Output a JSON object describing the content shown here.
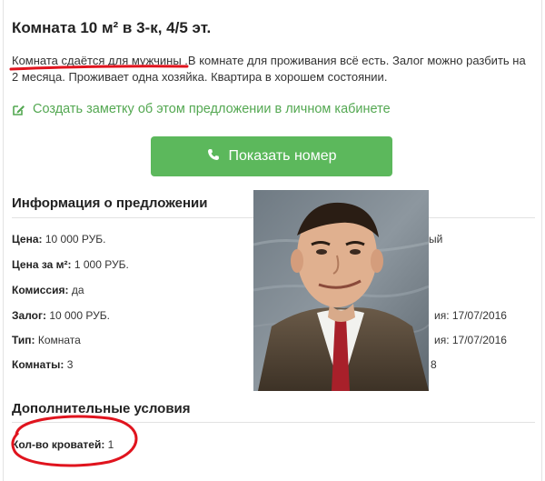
{
  "listing": {
    "title": "Комната 10 м² в 3-к, 4/5 эт.",
    "description_highlight": "Комната сдаётся для мужчины",
    "description_rest": " .В комнате для проживания всё есть. Залог можно разбить на 2 месяца. Проживает одна хозяйка. Квартира в хорошем состоянии."
  },
  "actions": {
    "note_link": "Создать заметку об этом предложении в личном кабинете",
    "show_phone": "Показать номер"
  },
  "info": {
    "title": "Информация о предложении",
    "rows": [
      {
        "label": "Цена:",
        "value": " 10 000 РУБ."
      },
      {
        "label": "Цена за м²:",
        "value": " 1 000 РУБ."
      },
      {
        "label": "Комиссия:",
        "value": " да"
      },
      {
        "label": "Залог:",
        "value": " 10 000 РУБ."
      },
      {
        "label": "Тип:",
        "value": " Комната"
      },
      {
        "label": "Комнаты:",
        "value": " 3"
      }
    ],
    "right_fragments": [
      "ый",
      "ия: 17/07/2016",
      "ия: 17/07/2016",
      "8"
    ]
  },
  "extra": {
    "title": "Дополнительные условия",
    "rows": [
      {
        "label": "Кол-во кроватей:",
        "value": " 1"
      }
    ]
  },
  "colors": {
    "accent_green": "#5cb85c",
    "link_green": "#54a852",
    "annotation_red": "#e0141e"
  }
}
